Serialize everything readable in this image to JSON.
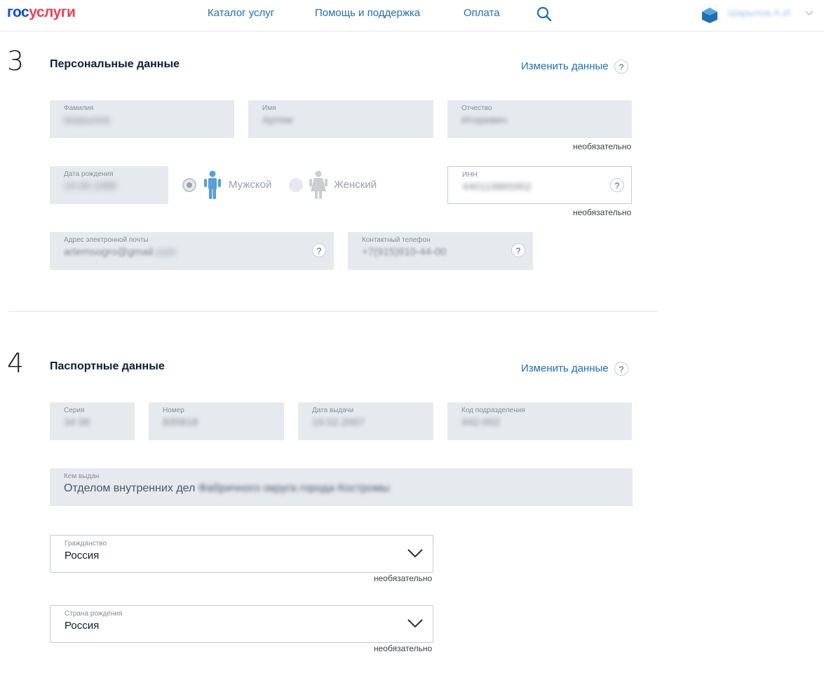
{
  "header": {
    "logo_part_a": "гос",
    "logo_part_b": "услуги",
    "nav": [
      "Каталог услуг",
      "Помощь и поддержка",
      "Оплата"
    ],
    "user_name": "Шарыпов А.И."
  },
  "personal": {
    "step": "3",
    "title": "Персональные данные",
    "change_link": "Изменить данные",
    "help": "?",
    "optional": "необязательно",
    "surname": {
      "label": "Фамилия",
      "value": "Шарыпов"
    },
    "name": {
      "label": "Имя",
      "value": "Артем"
    },
    "patronymic": {
      "label": "Отчество",
      "value": "Игоревич"
    },
    "birth_date": {
      "label": "Дата рождения",
      "value": "19.09.1986"
    },
    "gender": {
      "male": "Мужской",
      "female": "Женский",
      "selected": "male"
    },
    "inn": {
      "label": "ИНН",
      "value": "440119865902"
    },
    "email": {
      "label": "Адрес электронной почты",
      "value_visible": "artemsogro@gmail",
      "value_blurred": ".com"
    },
    "phone": {
      "label": "Контактный телефон",
      "value": "+7(915)910-44-00"
    }
  },
  "passport": {
    "step": "4",
    "title": "Паспортные данные",
    "change_link": "Изменить данные",
    "help": "?",
    "series": {
      "label": "Серия",
      "value": "34 06"
    },
    "number": {
      "label": "Номер",
      "value": "835818"
    },
    "issue_date": {
      "label": "Дата выдачи",
      "value": "19.02.2007"
    },
    "dept_code": {
      "label": "Код подразделения",
      "value": "442-002"
    },
    "issued_by": {
      "label": "Кем выдан",
      "value_visible": "Отделом внутренних дел",
      "value_blurred": "Фабричного округа города Костромы"
    },
    "citizenship": {
      "label": "Гражданство",
      "value": "Россия",
      "optional": "необязательно"
    },
    "birth_country": {
      "label": "Страна рождения",
      "value": "Россия",
      "optional": "необязательно"
    }
  },
  "colors": {
    "link": "#1f6fb1",
    "logo_blue": "#0d4cd3",
    "logo_red": "#ee3f58",
    "field_bg": "#e6eaee",
    "male_icon": "#5a9fd6"
  }
}
